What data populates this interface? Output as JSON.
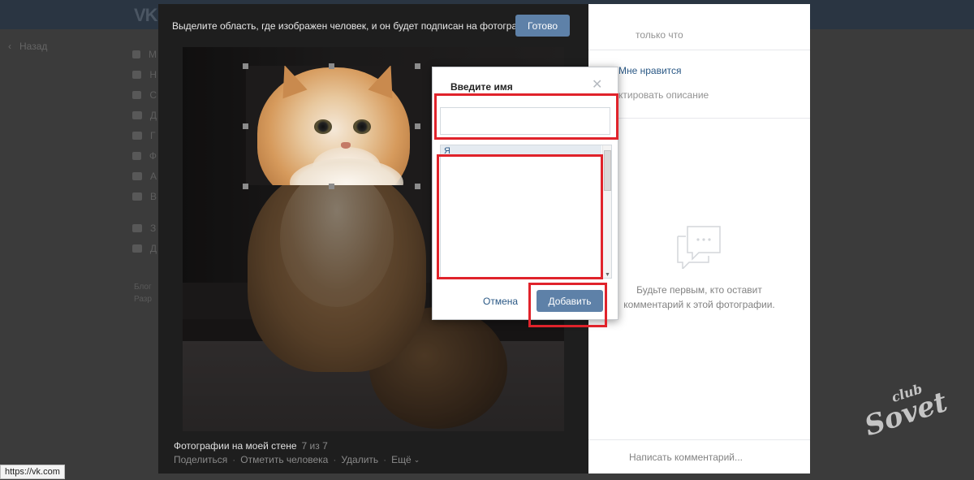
{
  "background": {
    "logo": "VK",
    "back_label": "Назад",
    "menu_letters": [
      "М",
      "Н",
      "С",
      "Д",
      "Г",
      "Ф",
      "А",
      "В",
      "З",
      "Д"
    ],
    "footer_lines": [
      "Блог",
      "Разр"
    ]
  },
  "viewer": {
    "instruction": "Выделите область, где изображен человек, и он будет подписан на фотографии.",
    "done_label": "Готово",
    "album_title": "Фотографии на моей стене",
    "counter": "7 из 7",
    "actions": {
      "share": "Поделиться",
      "tag_person": "Отметить человека",
      "delete": "Удалить",
      "more": "Ещё"
    }
  },
  "tag_popup": {
    "title": "Введите имя",
    "name_input_value": "",
    "name_input_placeholder": "",
    "list_items": [
      "Я"
    ],
    "cancel_label": "Отмена",
    "add_label": "Добавить"
  },
  "side_panel": {
    "author_name": "",
    "time": "только что",
    "like_label": "Мне нравится",
    "edit_description": "ктировать описание",
    "no_comments_line1": "Будьте первым, кто оставит",
    "no_comments_line2": "комментарий к этой фотографии.",
    "write_comment_placeholder": "Написать комментарий..."
  },
  "status_bar": {
    "url": "https://vk.com"
  },
  "watermark": {
    "line1": "club",
    "line2": "Sovet"
  },
  "colors": {
    "button_blue": "#5e81a8",
    "link_blue": "#2a5885",
    "highlight_red": "#e0232b"
  }
}
